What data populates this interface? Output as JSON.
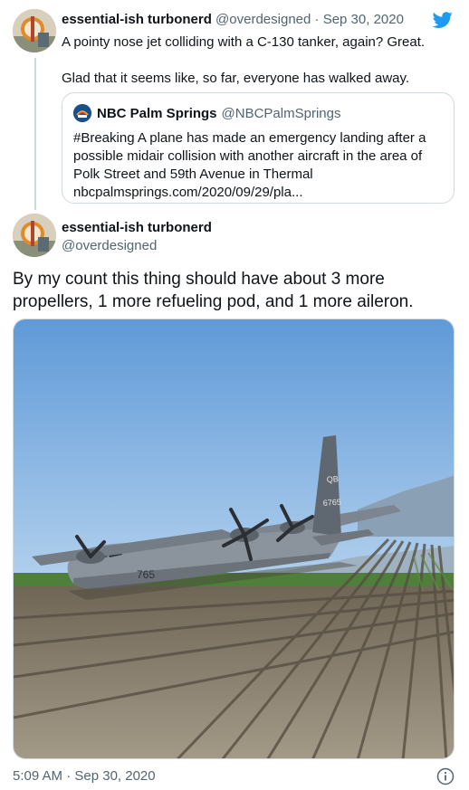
{
  "reply_tweet": {
    "name": "essential-ish turbonerd",
    "handle": "@overdesigned",
    "separator": "·",
    "date": "Sep 30, 2020",
    "text_line1": "A pointy nose jet colliding with a C-130 tanker, again?  Great.",
    "text_line2": "Glad that it seems like, so far, everyone has walked away."
  },
  "quoted_tweet": {
    "name": "NBC Palm Springs",
    "handle": "@NBCPalmSprings",
    "text": "#Breaking A plane has made an emergency landing after a possible midair collision with another aircraft in the area of Polk Street and 59th Avenue in Thermal nbcpalmsprings.com/2020/09/29/pla..."
  },
  "main_tweet": {
    "name": "essential-ish turbonerd",
    "handle": "@overdesigned",
    "text": "By my count this thing should have about 3 more propellers, 1 more refueling pod, and 1 more aileron.",
    "timestamp": "5:09 AM · Sep 30, 2020"
  },
  "photo": {
    "tail_code": "QB",
    "tail_number": "6765",
    "fuselage_number": "765"
  },
  "icons": {
    "brand": "twitter-bird-icon",
    "info": "info-icon"
  },
  "colors": {
    "twitter_blue": "#1d9bf0",
    "text": "#0f1419",
    "muted": "#536471",
    "border": "#cfd9de"
  }
}
